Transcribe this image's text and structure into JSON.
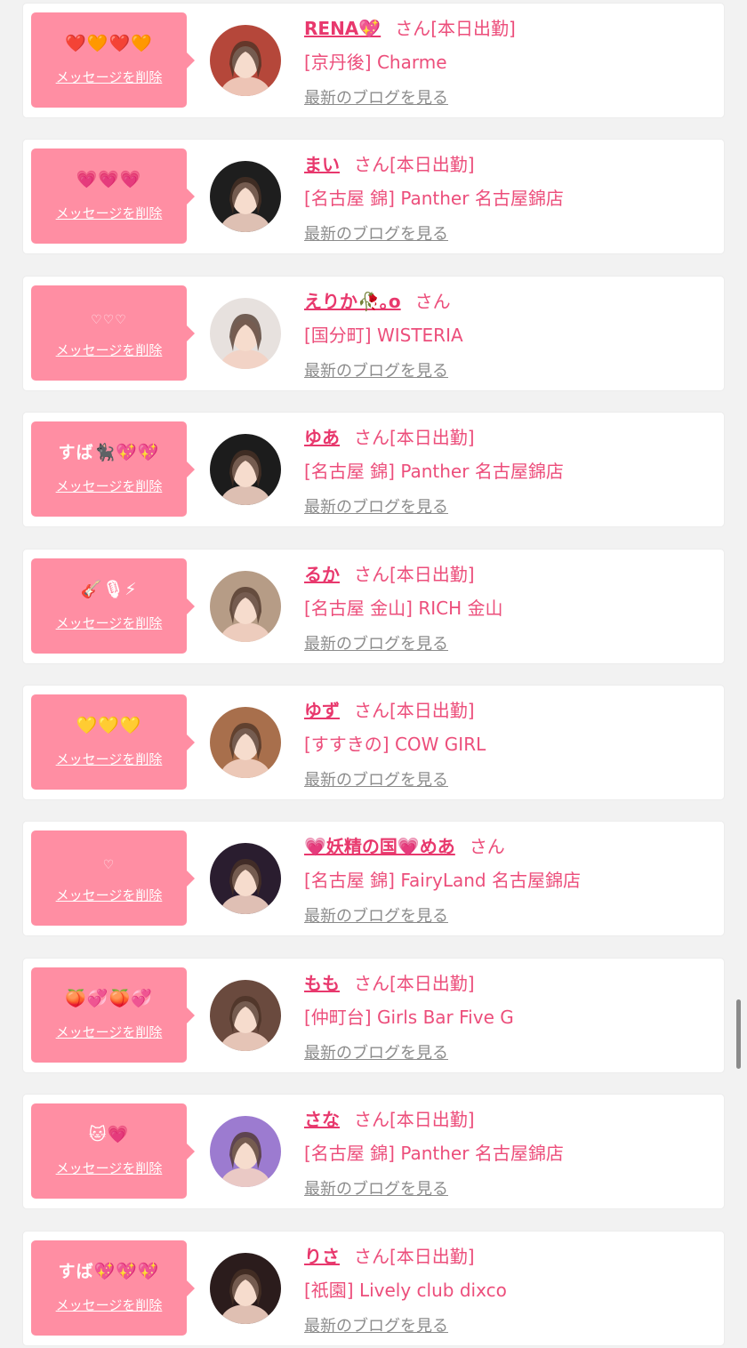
{
  "colors": {
    "bubble": "#ff8ea3",
    "accent": "#ec4e7b",
    "name": "#e8386d",
    "link_gray": "#8c8c8c",
    "background": "#f2f2f2"
  },
  "entries": [
    {
      "message": "❤️🧡❤️🧡",
      "delete_label": "メッセージを削除",
      "name": "RENA💖",
      "honorific": "さん",
      "status": "[本日出勤]",
      "shop": "[京丹後] Charme",
      "blog_link": "最新のブログを見る",
      "avatar_icon": "avatar-rena",
      "avatar_bg": "#b5473a"
    },
    {
      "message": "💗💗💗",
      "delete_label": "メッセージを削除",
      "name": "まい",
      "honorific": "さん",
      "status": "[本日出勤]",
      "shop": "[名古屋 錦] Panther 名古屋錦店",
      "blog_link": "最新のブログを見る",
      "avatar_icon": "avatar-mai",
      "avatar_bg": "#1e1e1e"
    },
    {
      "message": "♡♡♡",
      "delete_label": "メッセージを削除",
      "name": "えりか🥀｡o",
      "honorific": "さん",
      "status": "",
      "shop": "[国分町] WISTERIA",
      "blog_link": "最新のブログを見る",
      "avatar_icon": "avatar-erika",
      "avatar_bg": "#e7e1de"
    },
    {
      "message": "すば🐈‍⬛💖💖",
      "delete_label": "メッセージを削除",
      "name": "ゆあ",
      "honorific": "さん",
      "status": "[本日出勤]",
      "shop": "[名古屋 錦] Panther 名古屋錦店",
      "blog_link": "最新のブログを見る",
      "avatar_icon": "avatar-yua",
      "avatar_bg": "#1c1c1c"
    },
    {
      "message": "🎸🎙⚡",
      "delete_label": "メッセージを削除",
      "name": "るか",
      "honorific": "さん",
      "status": "[本日出勤]",
      "shop": "[名古屋 金山] RICH 金山",
      "blog_link": "最新のブログを見る",
      "avatar_icon": "avatar-ruka",
      "avatar_bg": "#b69c86"
    },
    {
      "message": "💛💛💛",
      "delete_label": "メッセージを削除",
      "name": "ゆず",
      "honorific": "さん",
      "status": "[本日出勤]",
      "shop": "[すすきの] COW GIRL",
      "blog_link": "最新のブログを見る",
      "avatar_icon": "avatar-yuzu",
      "avatar_bg": "#a86f4c"
    },
    {
      "message": "♡",
      "delete_label": "メッセージを削除",
      "name": "💗妖精の国💗めあ",
      "honorific": "さん",
      "status": "",
      "shop": "[名古屋 錦] FairyLand 名古屋錦店",
      "blog_link": "最新のブログを見る",
      "avatar_icon": "avatar-mea",
      "avatar_bg": "#2a1d2f"
    },
    {
      "message": "🍑💞🍑💞",
      "delete_label": "メッセージを削除",
      "name": "もも",
      "honorific": "さん",
      "status": "[本日出勤]",
      "shop": "[仲町台] Girls Bar Five G",
      "blog_link": "最新のブログを見る",
      "avatar_icon": "avatar-momo",
      "avatar_bg": "#6a4a3e"
    },
    {
      "message": "🐱💗",
      "delete_label": "メッセージを削除",
      "name": "さな",
      "honorific": "さん",
      "status": "[本日出勤]",
      "shop": "[名古屋 錦] Panther 名古屋錦店",
      "blog_link": "最新のブログを見る",
      "avatar_icon": "avatar-sana",
      "avatar_bg": "#9c7bd0"
    },
    {
      "message": "すば💖💖💖",
      "delete_label": "メッセージを削除",
      "name": "りさ",
      "honorific": "さん",
      "status": "[本日出勤]",
      "shop": "[祇園] Lively club dixco",
      "blog_link": "最新のブログを見る",
      "avatar_icon": "avatar-risa",
      "avatar_bg": "#2b1c1c"
    }
  ]
}
